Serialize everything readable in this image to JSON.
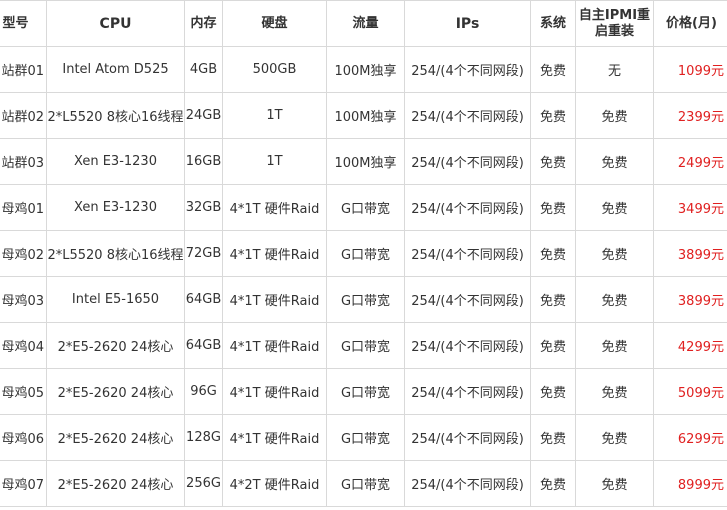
{
  "headers": {
    "model": "型号",
    "cpu": "CPU",
    "mem": "内存",
    "disk": "硬盘",
    "flow": "流量",
    "ips": "IPs",
    "sys": "系统",
    "ipmi": "自主IPMI重启重装",
    "price": "价格(月)"
  },
  "rows": [
    {
      "model": "站群01",
      "cpu": "Intel Atom D525",
      "mem": "4GB",
      "disk": "500GB",
      "flow": "100M独享",
      "ips": "254/(4个不同网段)",
      "sys": "免费",
      "ipmi": "无",
      "price": "1099元"
    },
    {
      "model": "站群02",
      "cpu": "2*L5520 8核心16线程",
      "mem": "24GB",
      "disk": "1T",
      "flow": "100M独享",
      "ips": "254/(4个不同网段)",
      "sys": "免费",
      "ipmi": "免费",
      "price": "2399元"
    },
    {
      "model": "站群03",
      "cpu": "Xen E3-1230",
      "mem": "16GB",
      "disk": "1T",
      "flow": "100M独享",
      "ips": "254/(4个不同网段)",
      "sys": "免费",
      "ipmi": "免费",
      "price": "2499元"
    },
    {
      "model": "母鸡01",
      "cpu": "Xen E3-1230",
      "mem": "32GB",
      "disk": "4*1T 硬件Raid",
      "flow": "G口带宽",
      "ips": "254/(4个不同网段)",
      "sys": "免费",
      "ipmi": "免费",
      "price": "3499元"
    },
    {
      "model": "母鸡02",
      "cpu": "2*L5520 8核心16线程",
      "mem": "72GB",
      "disk": "4*1T 硬件Raid",
      "flow": "G口带宽",
      "ips": "254/(4个不同网段)",
      "sys": "免费",
      "ipmi": "免费",
      "price": "3899元"
    },
    {
      "model": "母鸡03",
      "cpu": "Intel E5-1650",
      "mem": "64GB",
      "disk": "4*1T 硬件Raid",
      "flow": "G口带宽",
      "ips": "254/(4个不同网段)",
      "sys": "免费",
      "ipmi": "免费",
      "price": "3899元"
    },
    {
      "model": "母鸡04",
      "cpu": "2*E5-2620 24核心",
      "mem": "64GB",
      "disk": "4*1T 硬件Raid",
      "flow": "G口带宽",
      "ips": "254/(4个不同网段)",
      "sys": "免费",
      "ipmi": "免费",
      "price": "4299元"
    },
    {
      "model": "母鸡05",
      "cpu": "2*E5-2620 24核心",
      "mem": "96G",
      "disk": "4*1T 硬件Raid",
      "flow": "G口带宽",
      "ips": "254/(4个不同网段)",
      "sys": "免费",
      "ipmi": "免费",
      "price": "5099元"
    },
    {
      "model": "母鸡06",
      "cpu": "2*E5-2620 24核心",
      "mem": "128G",
      "disk": "4*1T 硬件Raid",
      "flow": "G口带宽",
      "ips": "254/(4个不同网段)",
      "sys": "免费",
      "ipmi": "免费",
      "price": "6299元"
    },
    {
      "model": "母鸡07",
      "cpu": "2*E5-2620 24核心",
      "mem": "256G",
      "disk": "4*2T 硬件Raid",
      "flow": "G口带宽",
      "ips": "254/(4个不同网段)",
      "sys": "免费",
      "ipmi": "免费",
      "price": "8999元"
    }
  ],
  "colors": {
    "price": "#e02020",
    "border": "#d9d9d9",
    "text": "#333333"
  }
}
